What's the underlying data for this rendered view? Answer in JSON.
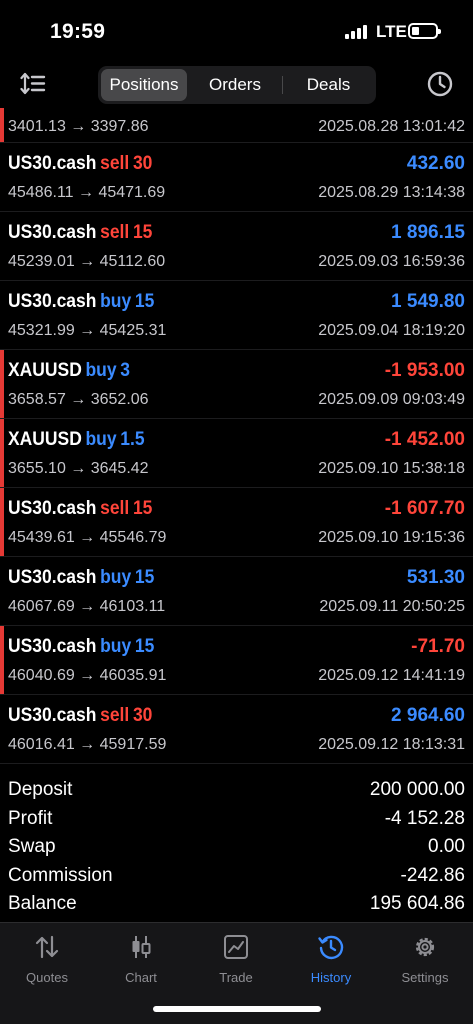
{
  "status": {
    "time": "19:59",
    "network": "LTE"
  },
  "nav": {
    "tabs": [
      {
        "label": "Positions",
        "active": true
      },
      {
        "label": "Orders",
        "active": false
      },
      {
        "label": "Deals",
        "active": false
      }
    ],
    "sort_icon": "sort-icon",
    "clock_icon": "clock-icon"
  },
  "colors": {
    "buy": "#3b8bff",
    "sell": "#ff453a",
    "positive": "#3b8bff",
    "negative": "#ff453a"
  },
  "deals_partial": {
    "prices": "3401.13 → 3397.86",
    "date": "2025.08.28 13:01:42"
  },
  "deals": [
    {
      "symbol": "US30.cash",
      "side": "sell",
      "volume": "30",
      "profit": "432.60",
      "prices": "45486.11 → 45471.69",
      "date": "2025.08.29 13:14:38"
    },
    {
      "symbol": "US30.cash",
      "side": "sell",
      "volume": "15",
      "profit": "1 896.15",
      "prices": "45239.01 → 45112.60",
      "date": "2025.09.03 16:59:36"
    },
    {
      "symbol": "US30.cash",
      "side": "buy",
      "volume": "15",
      "profit": "1 549.80",
      "prices": "45321.99 → 45425.31",
      "date": "2025.09.04 18:19:20"
    },
    {
      "symbol": "XAUUSD",
      "side": "buy",
      "volume": "3",
      "profit": "-1 953.00",
      "prices": "3658.57 → 3652.06",
      "date": "2025.09.09 09:03:49"
    },
    {
      "symbol": "XAUUSD",
      "side": "buy",
      "volume": "1.5",
      "profit": "-1 452.00",
      "prices": "3655.10 → 3645.42",
      "date": "2025.09.10 15:38:18"
    },
    {
      "symbol": "US30.cash",
      "side": "sell",
      "volume": "15",
      "profit": "-1 607.70",
      "prices": "45439.61 → 45546.79",
      "date": "2025.09.10 19:15:36"
    },
    {
      "symbol": "US30.cash",
      "side": "buy",
      "volume": "15",
      "profit": "531.30",
      "prices": "46067.69 → 46103.11",
      "date": "2025.09.11 20:50:25"
    },
    {
      "symbol": "US30.cash",
      "side": "buy",
      "volume": "15",
      "profit": "-71.70",
      "prices": "46040.69 → 46035.91",
      "date": "2025.09.12 14:41:19"
    },
    {
      "symbol": "US30.cash",
      "side": "sell",
      "volume": "30",
      "profit": "2 964.60",
      "prices": "46016.41 → 45917.59",
      "date": "2025.09.12 18:13:31"
    }
  ],
  "summary": [
    {
      "label": "Deposit",
      "value": "200 000.00"
    },
    {
      "label": "Profit",
      "value": "-4 152.28"
    },
    {
      "label": "Swap",
      "value": "0.00"
    },
    {
      "label": "Commission",
      "value": "-242.86"
    },
    {
      "label": "Balance",
      "value": "195 604.86"
    }
  ],
  "tabbar": [
    {
      "label": "Quotes",
      "icon": "quotes-icon",
      "active": false
    },
    {
      "label": "Chart",
      "icon": "candlestick-icon",
      "active": false
    },
    {
      "label": "Trade",
      "icon": "trade-chart-icon",
      "active": false
    },
    {
      "label": "History",
      "icon": "history-icon",
      "active": true
    },
    {
      "label": "Settings",
      "icon": "gear-icon",
      "active": false
    }
  ]
}
